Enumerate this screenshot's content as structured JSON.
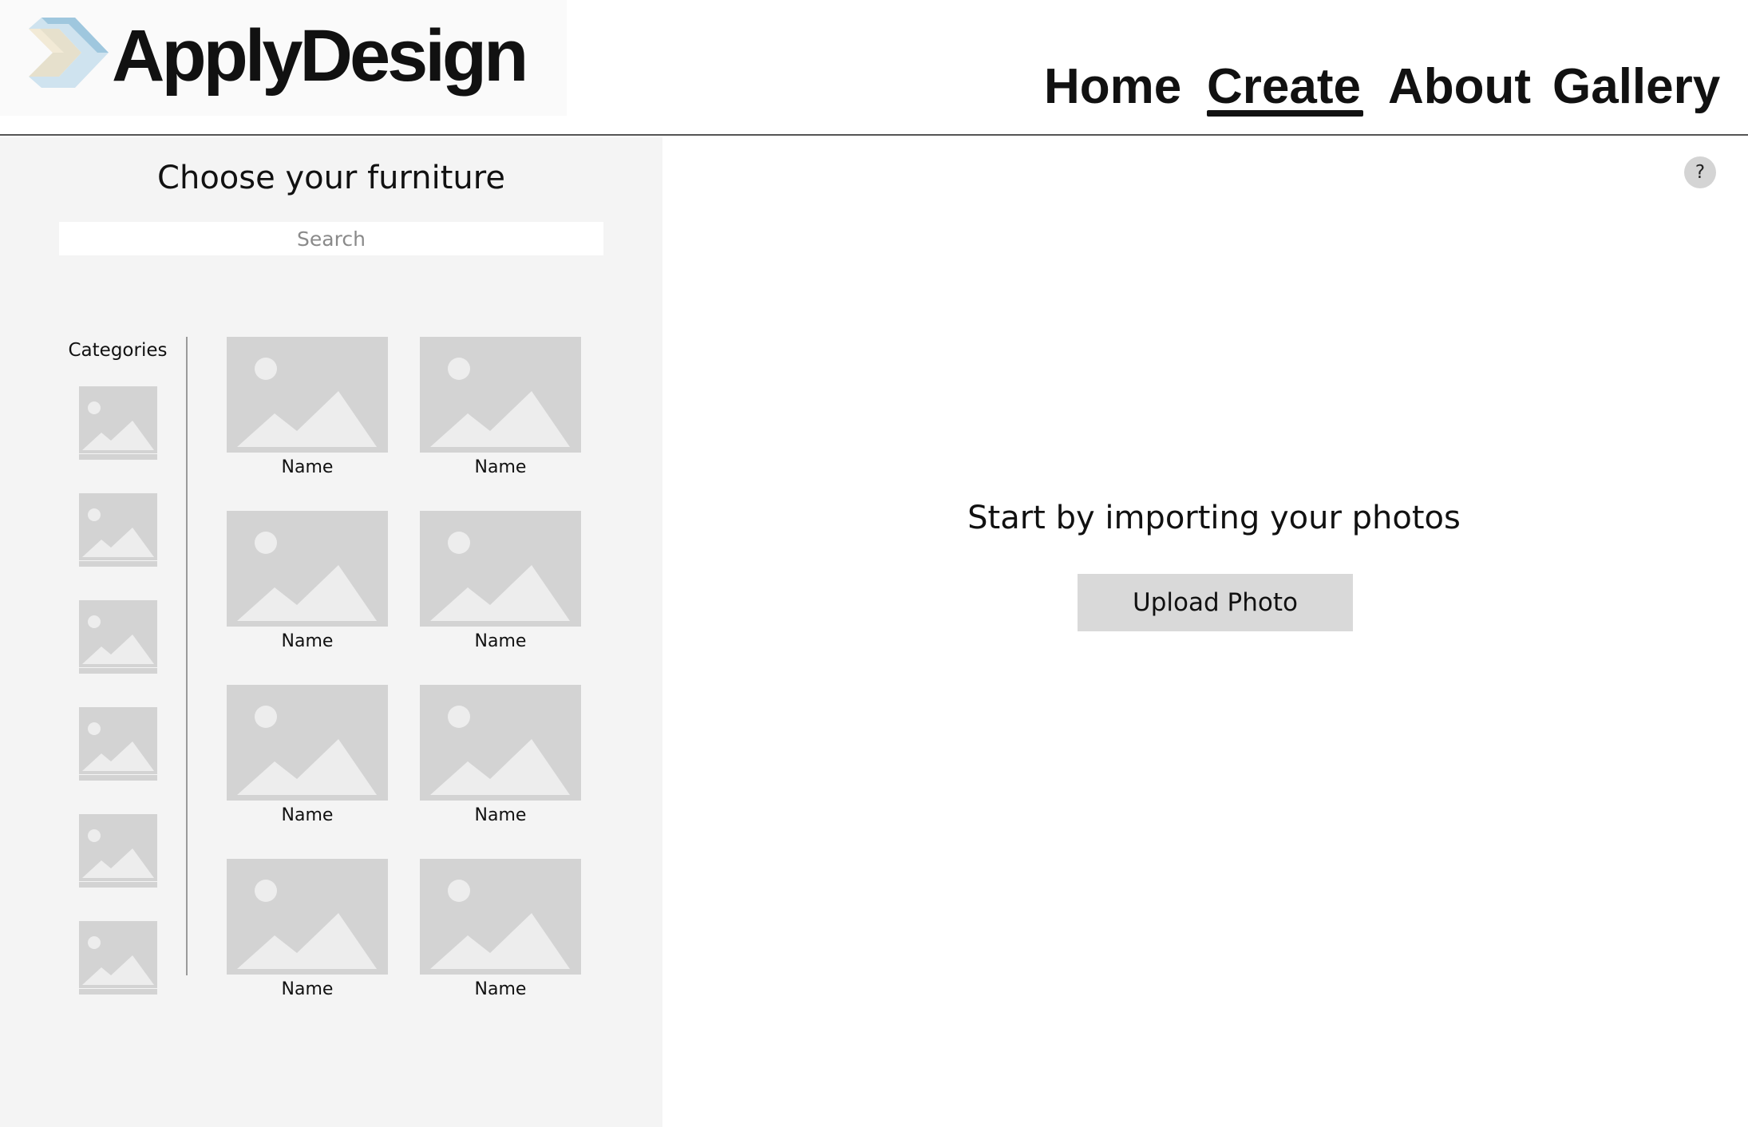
{
  "header": {
    "logo_text": "ApplyDesign",
    "nav": {
      "home": "Home",
      "create": "Create",
      "about": "About",
      "gallery": "Gallery"
    },
    "active_nav": "Create"
  },
  "sidebar": {
    "title": "Choose your furniture",
    "search_placeholder": "Search",
    "search_value": "",
    "categories_label": "Categories",
    "category_icons": [
      "image-placeholder-icon",
      "image-placeholder-icon",
      "image-placeholder-icon",
      "image-placeholder-icon",
      "image-placeholder-icon",
      "image-placeholder-icon"
    ],
    "products": [
      {
        "name": "Name"
      },
      {
        "name": "Name"
      },
      {
        "name": "Name"
      },
      {
        "name": "Name"
      },
      {
        "name": "Name"
      },
      {
        "name": "Name"
      },
      {
        "name": "Name"
      },
      {
        "name": "Name"
      }
    ]
  },
  "main": {
    "help_label": "?",
    "prompt": "Start by importing your photos",
    "upload_label": "Upload Photo"
  },
  "colors": {
    "placeholder_gray": "#d3d3d3",
    "sidebar_bg": "#f4f4f4",
    "button_gray": "#d9d9d9",
    "text": "#111111"
  }
}
